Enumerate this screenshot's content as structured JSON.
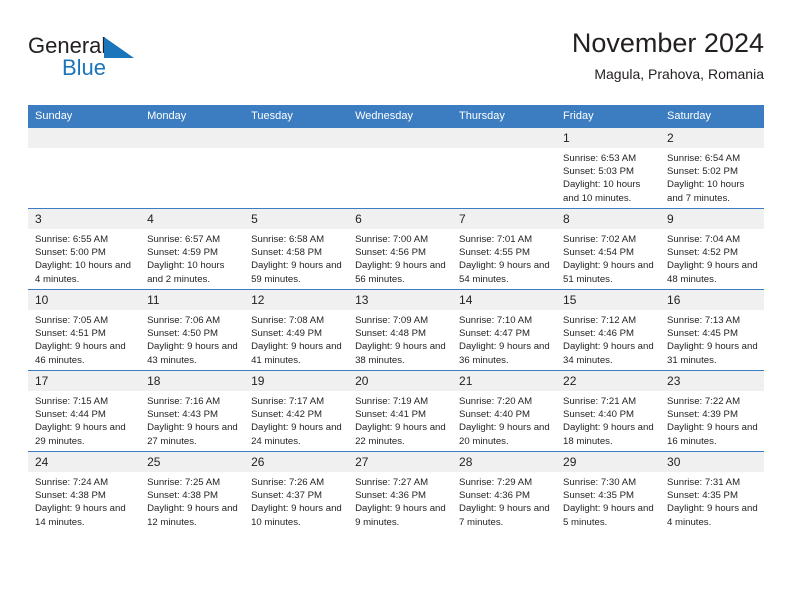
{
  "brand": {
    "name_part1": "General",
    "name_part2": "Blue",
    "mark": "triangle-flag-icon",
    "accent_color": "#1b75bb"
  },
  "header": {
    "title": "November 2024",
    "subtitle": "Magula, Prahova, Romania"
  },
  "theme": {
    "header_row_bg": "#3b7dc0",
    "daynum_bg": "#f0f0f0",
    "text_color": "#231f20",
    "page_bg": "#ffffff"
  },
  "weekday_headers": [
    "Sunday",
    "Monday",
    "Tuesday",
    "Wednesday",
    "Thursday",
    "Friday",
    "Saturday"
  ],
  "labels": {
    "sunrise_prefix": "Sunrise:",
    "sunset_prefix": "Sunset:",
    "daylight_prefix": "Daylight:"
  },
  "weeks": [
    [
      {
        "day": "",
        "empty": true
      },
      {
        "day": "",
        "empty": true
      },
      {
        "day": "",
        "empty": true
      },
      {
        "day": "",
        "empty": true
      },
      {
        "day": "",
        "empty": true
      },
      {
        "day": "1",
        "sunrise": "Sunrise: 6:53 AM",
        "sunset": "Sunset: 5:03 PM",
        "daylight": "Daylight: 10 hours and 10 minutes."
      },
      {
        "day": "2",
        "sunrise": "Sunrise: 6:54 AM",
        "sunset": "Sunset: 5:02 PM",
        "daylight": "Daylight: 10 hours and 7 minutes."
      }
    ],
    [
      {
        "day": "3",
        "sunrise": "Sunrise: 6:55 AM",
        "sunset": "Sunset: 5:00 PM",
        "daylight": "Daylight: 10 hours and 4 minutes."
      },
      {
        "day": "4",
        "sunrise": "Sunrise: 6:57 AM",
        "sunset": "Sunset: 4:59 PM",
        "daylight": "Daylight: 10 hours and 2 minutes."
      },
      {
        "day": "5",
        "sunrise": "Sunrise: 6:58 AM",
        "sunset": "Sunset: 4:58 PM",
        "daylight": "Daylight: 9 hours and 59 minutes."
      },
      {
        "day": "6",
        "sunrise": "Sunrise: 7:00 AM",
        "sunset": "Sunset: 4:56 PM",
        "daylight": "Daylight: 9 hours and 56 minutes."
      },
      {
        "day": "7",
        "sunrise": "Sunrise: 7:01 AM",
        "sunset": "Sunset: 4:55 PM",
        "daylight": "Daylight: 9 hours and 54 minutes."
      },
      {
        "day": "8",
        "sunrise": "Sunrise: 7:02 AM",
        "sunset": "Sunset: 4:54 PM",
        "daylight": "Daylight: 9 hours and 51 minutes."
      },
      {
        "day": "9",
        "sunrise": "Sunrise: 7:04 AM",
        "sunset": "Sunset: 4:52 PM",
        "daylight": "Daylight: 9 hours and 48 minutes."
      }
    ],
    [
      {
        "day": "10",
        "sunrise": "Sunrise: 7:05 AM",
        "sunset": "Sunset: 4:51 PM",
        "daylight": "Daylight: 9 hours and 46 minutes."
      },
      {
        "day": "11",
        "sunrise": "Sunrise: 7:06 AM",
        "sunset": "Sunset: 4:50 PM",
        "daylight": "Daylight: 9 hours and 43 minutes."
      },
      {
        "day": "12",
        "sunrise": "Sunrise: 7:08 AM",
        "sunset": "Sunset: 4:49 PM",
        "daylight": "Daylight: 9 hours and 41 minutes."
      },
      {
        "day": "13",
        "sunrise": "Sunrise: 7:09 AM",
        "sunset": "Sunset: 4:48 PM",
        "daylight": "Daylight: 9 hours and 38 minutes."
      },
      {
        "day": "14",
        "sunrise": "Sunrise: 7:10 AM",
        "sunset": "Sunset: 4:47 PM",
        "daylight": "Daylight: 9 hours and 36 minutes."
      },
      {
        "day": "15",
        "sunrise": "Sunrise: 7:12 AM",
        "sunset": "Sunset: 4:46 PM",
        "daylight": "Daylight: 9 hours and 34 minutes."
      },
      {
        "day": "16",
        "sunrise": "Sunrise: 7:13 AM",
        "sunset": "Sunset: 4:45 PM",
        "daylight": "Daylight: 9 hours and 31 minutes."
      }
    ],
    [
      {
        "day": "17",
        "sunrise": "Sunrise: 7:15 AM",
        "sunset": "Sunset: 4:44 PM",
        "daylight": "Daylight: 9 hours and 29 minutes."
      },
      {
        "day": "18",
        "sunrise": "Sunrise: 7:16 AM",
        "sunset": "Sunset: 4:43 PM",
        "daylight": "Daylight: 9 hours and 27 minutes."
      },
      {
        "day": "19",
        "sunrise": "Sunrise: 7:17 AM",
        "sunset": "Sunset: 4:42 PM",
        "daylight": "Daylight: 9 hours and 24 minutes."
      },
      {
        "day": "20",
        "sunrise": "Sunrise: 7:19 AM",
        "sunset": "Sunset: 4:41 PM",
        "daylight": "Daylight: 9 hours and 22 minutes."
      },
      {
        "day": "21",
        "sunrise": "Sunrise: 7:20 AM",
        "sunset": "Sunset: 4:40 PM",
        "daylight": "Daylight: 9 hours and 20 minutes."
      },
      {
        "day": "22",
        "sunrise": "Sunrise: 7:21 AM",
        "sunset": "Sunset: 4:40 PM",
        "daylight": "Daylight: 9 hours and 18 minutes."
      },
      {
        "day": "23",
        "sunrise": "Sunrise: 7:22 AM",
        "sunset": "Sunset: 4:39 PM",
        "daylight": "Daylight: 9 hours and 16 minutes."
      }
    ],
    [
      {
        "day": "24",
        "sunrise": "Sunrise: 7:24 AM",
        "sunset": "Sunset: 4:38 PM",
        "daylight": "Daylight: 9 hours and 14 minutes."
      },
      {
        "day": "25",
        "sunrise": "Sunrise: 7:25 AM",
        "sunset": "Sunset: 4:38 PM",
        "daylight": "Daylight: 9 hours and 12 minutes."
      },
      {
        "day": "26",
        "sunrise": "Sunrise: 7:26 AM",
        "sunset": "Sunset: 4:37 PM",
        "daylight": "Daylight: 9 hours and 10 minutes."
      },
      {
        "day": "27",
        "sunrise": "Sunrise: 7:27 AM",
        "sunset": "Sunset: 4:36 PM",
        "daylight": "Daylight: 9 hours and 9 minutes."
      },
      {
        "day": "28",
        "sunrise": "Sunrise: 7:29 AM",
        "sunset": "Sunset: 4:36 PM",
        "daylight": "Daylight: 9 hours and 7 minutes."
      },
      {
        "day": "29",
        "sunrise": "Sunrise: 7:30 AM",
        "sunset": "Sunset: 4:35 PM",
        "daylight": "Daylight: 9 hours and 5 minutes."
      },
      {
        "day": "30",
        "sunrise": "Sunrise: 7:31 AM",
        "sunset": "Sunset: 4:35 PM",
        "daylight": "Daylight: 9 hours and 4 minutes."
      }
    ]
  ]
}
